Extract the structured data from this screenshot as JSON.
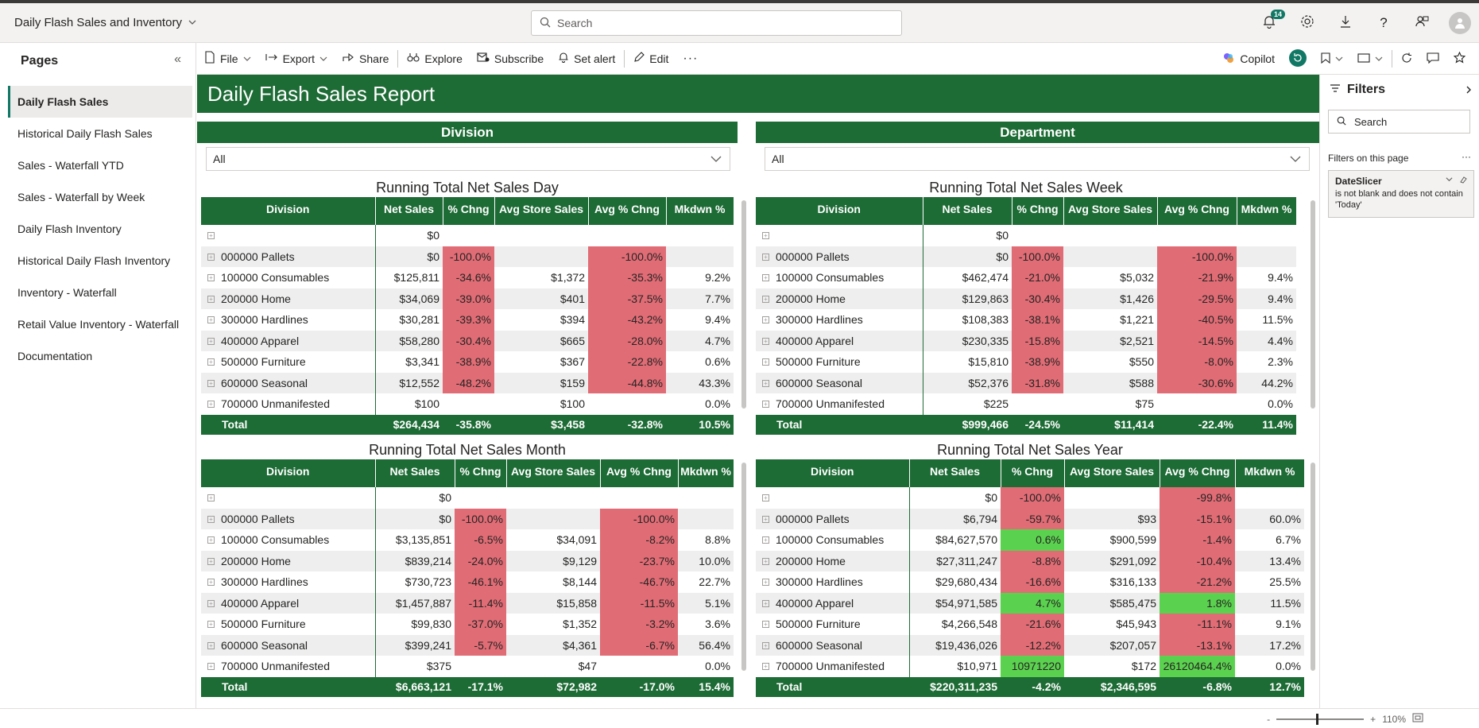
{
  "app": {
    "title": "Daily Flash Sales and Inventory"
  },
  "search": {
    "placeholder": "Search"
  },
  "notifications": {
    "count": "14"
  },
  "pages": {
    "header": "Pages",
    "items": [
      "Daily Flash Sales",
      "Historical Daily Flash Sales",
      "Sales - Waterfall YTD",
      "Sales - Waterfall by Week",
      "Daily Flash Inventory",
      "Historical Daily Flash Inventory",
      "Inventory - Waterfall",
      "Retail Value Inventory - Waterfall",
      "Documentation"
    ]
  },
  "toolbar": {
    "file": "File",
    "export": "Export",
    "share": "Share",
    "explore": "Explore",
    "subscribe": "Subscribe",
    "set_alert": "Set alert",
    "edit": "Edit",
    "copilot": "Copilot"
  },
  "report": {
    "title": "Daily Flash Sales Report",
    "division_slicer": {
      "header": "Division",
      "value": "All"
    },
    "department_slicer": {
      "header": "Department",
      "value": "All"
    }
  },
  "columns": [
    "Division",
    "Net Sales",
    "% Chng",
    "Avg Store Sales",
    "Avg % Chng",
    "Mkdwn %"
  ],
  "matrices": {
    "day": {
      "title": "Running Total Net Sales Day",
      "rows": [
        [
          "",
          "$0",
          "",
          "",
          "",
          ""
        ],
        [
          "000000 Pallets",
          "$0",
          "-100.0%",
          "",
          "-100.0%",
          ""
        ],
        [
          "100000 Consumables",
          "$125,811",
          "-34.6%",
          "$1,372",
          "-35.3%",
          "9.2%"
        ],
        [
          "200000 Home",
          "$34,069",
          "-39.0%",
          "$401",
          "-37.5%",
          "7.7%"
        ],
        [
          "300000 Hardlines",
          "$30,281",
          "-39.3%",
          "$394",
          "-43.2%",
          "9.4%"
        ],
        [
          "400000 Apparel",
          "$58,280",
          "-30.4%",
          "$665",
          "-28.0%",
          "4.7%"
        ],
        [
          "500000 Furniture",
          "$3,341",
          "-38.9%",
          "$367",
          "-22.8%",
          "0.6%"
        ],
        [
          "600000 Seasonal",
          "$12,552",
          "-48.2%",
          "$159",
          "-44.8%",
          "43.3%"
        ],
        [
          "700000 Unmanifested",
          "$100",
          "",
          "$100",
          "",
          "0.0%"
        ]
      ],
      "total": [
        "Total",
        "$264,434",
        "-35.8%",
        "$3,458",
        "-32.8%",
        "10.5%"
      ]
    },
    "week": {
      "title": "Running Total Net Sales Week",
      "rows": [
        [
          "",
          "$0",
          "",
          "",
          "",
          ""
        ],
        [
          "000000 Pallets",
          "$0",
          "-100.0%",
          "",
          "-100.0%",
          ""
        ],
        [
          "100000 Consumables",
          "$462,474",
          "-21.0%",
          "$5,032",
          "-21.9%",
          "9.4%"
        ],
        [
          "200000 Home",
          "$129,863",
          "-30.4%",
          "$1,426",
          "-29.5%",
          "9.4%"
        ],
        [
          "300000 Hardlines",
          "$108,383",
          "-38.1%",
          "$1,221",
          "-40.5%",
          "11.5%"
        ],
        [
          "400000 Apparel",
          "$230,335",
          "-15.8%",
          "$2,521",
          "-14.5%",
          "4.4%"
        ],
        [
          "500000 Furniture",
          "$15,810",
          "-38.9%",
          "$550",
          "-8.0%",
          "2.3%"
        ],
        [
          "600000 Seasonal",
          "$52,376",
          "-31.8%",
          "$588",
          "-30.6%",
          "44.2%"
        ],
        [
          "700000 Unmanifested",
          "$225",
          "",
          "$75",
          "",
          "0.0%"
        ]
      ],
      "total": [
        "Total",
        "$999,466",
        "-24.5%",
        "$11,414",
        "-22.4%",
        "11.4%"
      ]
    },
    "month": {
      "title": "Running Total Net Sales Month",
      "rows": [
        [
          "",
          "$0",
          "",
          "",
          "",
          ""
        ],
        [
          "000000 Pallets",
          "$0",
          "-100.0%",
          "",
          "-100.0%",
          ""
        ],
        [
          "100000 Consumables",
          "$3,135,851",
          "-6.5%",
          "$34,091",
          "-8.2%",
          "8.8%"
        ],
        [
          "200000 Home",
          "$839,214",
          "-24.0%",
          "$9,129",
          "-23.7%",
          "10.0%"
        ],
        [
          "300000 Hardlines",
          "$730,723",
          "-46.1%",
          "$8,144",
          "-46.7%",
          "22.7%"
        ],
        [
          "400000 Apparel",
          "$1,457,887",
          "-11.4%",
          "$15,858",
          "-11.5%",
          "5.1%"
        ],
        [
          "500000 Furniture",
          "$99,830",
          "-37.0%",
          "$1,352",
          "-3.2%",
          "3.6%"
        ],
        [
          "600000 Seasonal",
          "$399,241",
          "-5.7%",
          "$4,361",
          "-6.7%",
          "56.4%"
        ],
        [
          "700000 Unmanifested",
          "$375",
          "",
          "$47",
          "",
          "0.0%"
        ]
      ],
      "total": [
        "Total",
        "$6,663,121",
        "-17.1%",
        "$72,982",
        "-17.0%",
        "15.4%"
      ]
    },
    "year": {
      "title": "Running Total Net Sales Year",
      "rows": [
        [
          "",
          "$0",
          "-100.0%",
          "",
          "-99.8%",
          ""
        ],
        [
          "000000 Pallets",
          "$6,794",
          "-59.7%",
          "$93",
          "-15.1%",
          "60.0%"
        ],
        [
          "100000 Consumables",
          "$84,627,570",
          "0.6%",
          "$900,599",
          "-1.4%",
          "6.7%"
        ],
        [
          "200000 Home",
          "$27,311,247",
          "-8.8%",
          "$291,092",
          "-10.4%",
          "13.4%"
        ],
        [
          "300000 Hardlines",
          "$29,680,434",
          "-16.6%",
          "$316,133",
          "-21.2%",
          "25.5%"
        ],
        [
          "400000 Apparel",
          "$54,971,585",
          "4.7%",
          "$585,475",
          "1.8%",
          "11.5%"
        ],
        [
          "500000 Furniture",
          "$4,266,548",
          "-21.6%",
          "$45,943",
          "-11.1%",
          "9.1%"
        ],
        [
          "600000 Seasonal",
          "$19,436,026",
          "-12.2%",
          "$207,057",
          "-13.1%",
          "17.2%"
        ],
        [
          "700000 Unmanifested",
          "$10,971",
          "10971220",
          "$172",
          "26120464.4%",
          "0.0%"
        ]
      ],
      "total": [
        "Total",
        "$220,311,235",
        "-4.2%",
        "$2,346,595",
        "-6.8%",
        "12.7%"
      ]
    }
  },
  "filters": {
    "header": "Filters",
    "search_placeholder": "Search",
    "on_page_label": "Filters on this page",
    "card_title": "DateSlicer",
    "card_desc": "is not blank and does not contain 'Today'"
  },
  "status": {
    "zoom": "110%"
  },
  "colors": {
    "header_green": "#1d6b35",
    "negative": "#e06c75",
    "positive": "#5bd24f"
  }
}
